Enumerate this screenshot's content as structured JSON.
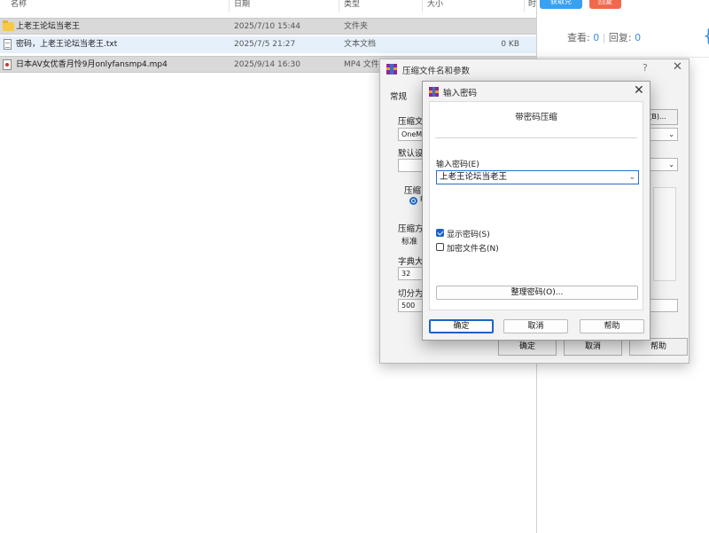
{
  "explorer": {
    "columns": {
      "name": "名称",
      "date": "日期",
      "type": "类型",
      "size": "大小",
      "extra": "时"
    },
    "rows": [
      {
        "name": "上老王论坛当老王",
        "date": "2025/7/10 15:44",
        "type": "文件夹",
        "size": "",
        "icon": "folder-icon"
      },
      {
        "name": "密码，上老王论坛当老王.txt",
        "date": "2025/7/5 21:27",
        "type": "文本文档",
        "size": "0 KB",
        "icon": "text-file-icon"
      },
      {
        "name": "日本AV女优香月怜9月onlyfansmp4.mp4",
        "date": "2025/9/14 16:30",
        "type": "MP4 文件",
        "size": "",
        "icon": "video-file-icon"
      }
    ]
  },
  "webpane": {
    "btn_blue": "获取兑",
    "btn_red": "回复",
    "views_label": "查看:",
    "views_value": "0",
    "replies_label": "回复:",
    "replies_value": "0"
  },
  "back_dialog": {
    "title": "压缩文件名和参数",
    "help_glyph": "?",
    "tab": "常规",
    "label_archive": "压缩文",
    "archive_value": "OneMc",
    "browse_btn": "(B)...",
    "label_default": "默认设",
    "label_format": "压缩",
    "format_option": "R",
    "label_method": "压缩方",
    "method_value": "标准",
    "label_dict": "字典大",
    "dict_value": "32",
    "label_split": "切分为",
    "split_value": "500",
    "ok": "确定",
    "cancel": "取消",
    "help": "帮助"
  },
  "front_dialog": {
    "title": "输入密码",
    "heading": "带密码压缩",
    "enter_label": "输入密码(E)",
    "password_value": "上老王论坛当老王",
    "show_password": "显示密码(S)",
    "show_password_checked": true,
    "encrypt_names": "加密文件名(N)",
    "encrypt_names_checked": false,
    "organize": "整理密码(O)...",
    "ok": "确定",
    "cancel": "取消",
    "help": "帮助"
  }
}
